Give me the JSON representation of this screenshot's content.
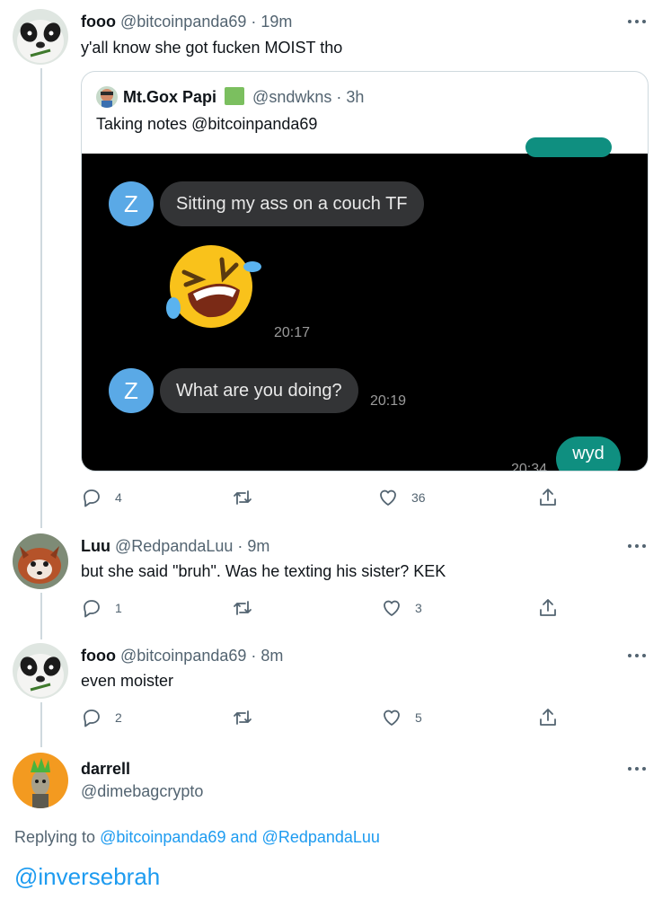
{
  "tweets": [
    {
      "name": "fooo",
      "handle": "@bitcoinpanda69",
      "time": "· 19m",
      "text": "y'all know she got fucken MOIST tho",
      "replies": "4",
      "likes": "36",
      "quote": {
        "name": "Mt.Gox Papi",
        "handle": "@sndwkns",
        "time": "· 3h",
        "text": "Taking notes @bitcoinpanda69",
        "chat": {
          "z_label": "Z",
          "msg1": "Sitting my ass on a couch TF",
          "time1": "20:17",
          "msg2": "What are you doing?",
          "time2": "20:19",
          "reply": "wyd",
          "time3": "20:34"
        }
      }
    },
    {
      "name": "Luu",
      "handle": "@RedpandaLuu",
      "time": "· 9m",
      "text": "but she said \"bruh\". Was he texting his sister? KEK",
      "replies": "1",
      "likes": "3"
    },
    {
      "name": "fooo",
      "handle": "@bitcoinpanda69",
      "time": "· 8m",
      "text": "even moister",
      "replies": "2",
      "likes": "5"
    }
  ],
  "composer": {
    "name": "darrell",
    "handle": "@dimebagcrypto",
    "replying_prefix": "Replying to",
    "replying_user1": "@bitcoinpanda69",
    "replying_and": "and",
    "replying_user2": "@RedpandaLuu",
    "draft": "@inversebrah"
  },
  "colors": {
    "accent": "#1d9bf0",
    "secondary_text": "#536471",
    "border": "#cfd9de",
    "verified_square": "#7bbf5f",
    "chat_bubble": "#333436",
    "chat_reply": "#0f8f80",
    "z_avatar": "#5aa9e6"
  },
  "icons": [
    "more-icon",
    "reply-icon",
    "retweet-icon",
    "like-icon",
    "share-icon",
    "laughing-emoji-icon"
  ]
}
